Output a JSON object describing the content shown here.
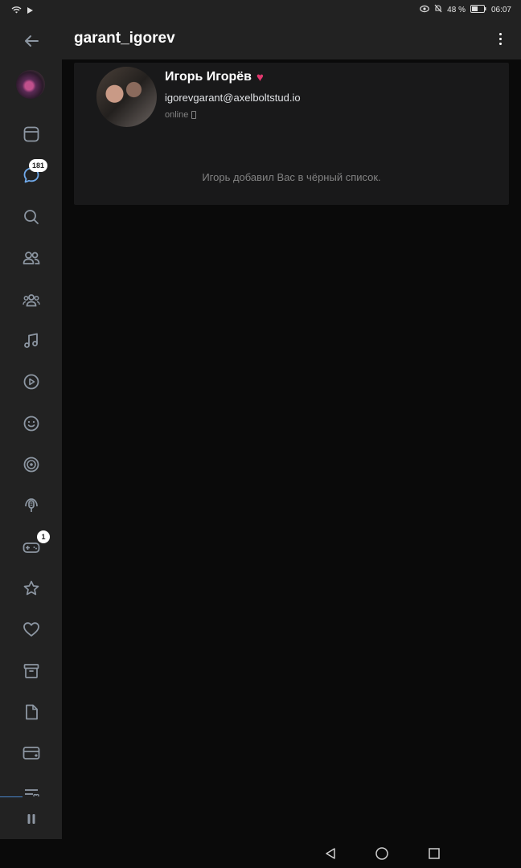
{
  "status_bar": {
    "battery": "48 %",
    "time": "06:07"
  },
  "header": {
    "title": "garant_igorev"
  },
  "sidebar": {
    "items": [
      {
        "name": "back",
        "icon": "arrow-left-icon"
      },
      {
        "name": "profile",
        "icon": "avatar"
      },
      {
        "name": "news",
        "icon": "newsfeed-icon"
      },
      {
        "name": "messages",
        "icon": "chat-icon",
        "badge": "181"
      },
      {
        "name": "search",
        "icon": "search-icon"
      },
      {
        "name": "friends",
        "icon": "friends-icon"
      },
      {
        "name": "communities",
        "icon": "groups-icon"
      },
      {
        "name": "music",
        "icon": "music-icon"
      },
      {
        "name": "video",
        "icon": "play-icon"
      },
      {
        "name": "stickers",
        "icon": "smile-icon"
      },
      {
        "name": "podcasts",
        "icon": "target-icon"
      },
      {
        "name": "live",
        "icon": "microphone-icon"
      },
      {
        "name": "games",
        "icon": "gamepad-icon",
        "badge": "1"
      },
      {
        "name": "bookmarks",
        "icon": "star-icon"
      },
      {
        "name": "likes",
        "icon": "heart-icon"
      },
      {
        "name": "archive",
        "icon": "archive-icon"
      },
      {
        "name": "documents",
        "icon": "document-icon"
      },
      {
        "name": "payments",
        "icon": "card-icon"
      },
      {
        "name": "settings",
        "icon": "list-icon"
      },
      {
        "name": "player",
        "icon": "pause-icon"
      }
    ]
  },
  "profile": {
    "name": "Игорь Игорёв",
    "email": "igorevgarant@axelboltstud.io",
    "status": "online",
    "block_message": "Игорь добавил Вас в чёрный список."
  },
  "colors": {
    "background": "#0a0a0a",
    "panel": "#222222",
    "card": "#19191a",
    "accent_heart": "#e2386e",
    "link_blue": "#4986cc"
  }
}
